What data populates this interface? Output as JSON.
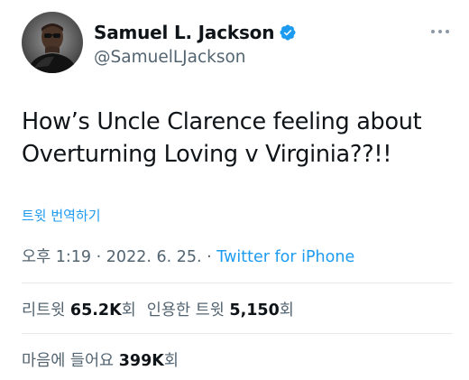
{
  "user": {
    "display_name": "Samuel L. Jackson",
    "handle": "@SamuelLJackson",
    "verified": true
  },
  "tweet": {
    "text": "How’s Uncle Clarence feeling about Overturning Loving v Virginia??!!",
    "translate_label": "트윗 번역하기",
    "time": "오후 1:19",
    "date": "2022. 6. 25.",
    "separator": "·",
    "source": "Twitter for iPhone"
  },
  "stats": {
    "retweets_label": "리트윗",
    "retweets_value": "65.2K",
    "retweets_unit": "회",
    "quotes_label": "인용한 트윗",
    "quotes_value": "5,150",
    "quotes_unit": "회",
    "likes_label": "마음에 들어요",
    "likes_value": "399K",
    "likes_unit": "회"
  },
  "icons": {
    "verified": "verified-badge-icon",
    "more": "more-options-icon"
  },
  "colors": {
    "accent": "#1d9bf0",
    "muted": "#536471",
    "text": "#0f1419",
    "divider": "#e7e9ea"
  }
}
